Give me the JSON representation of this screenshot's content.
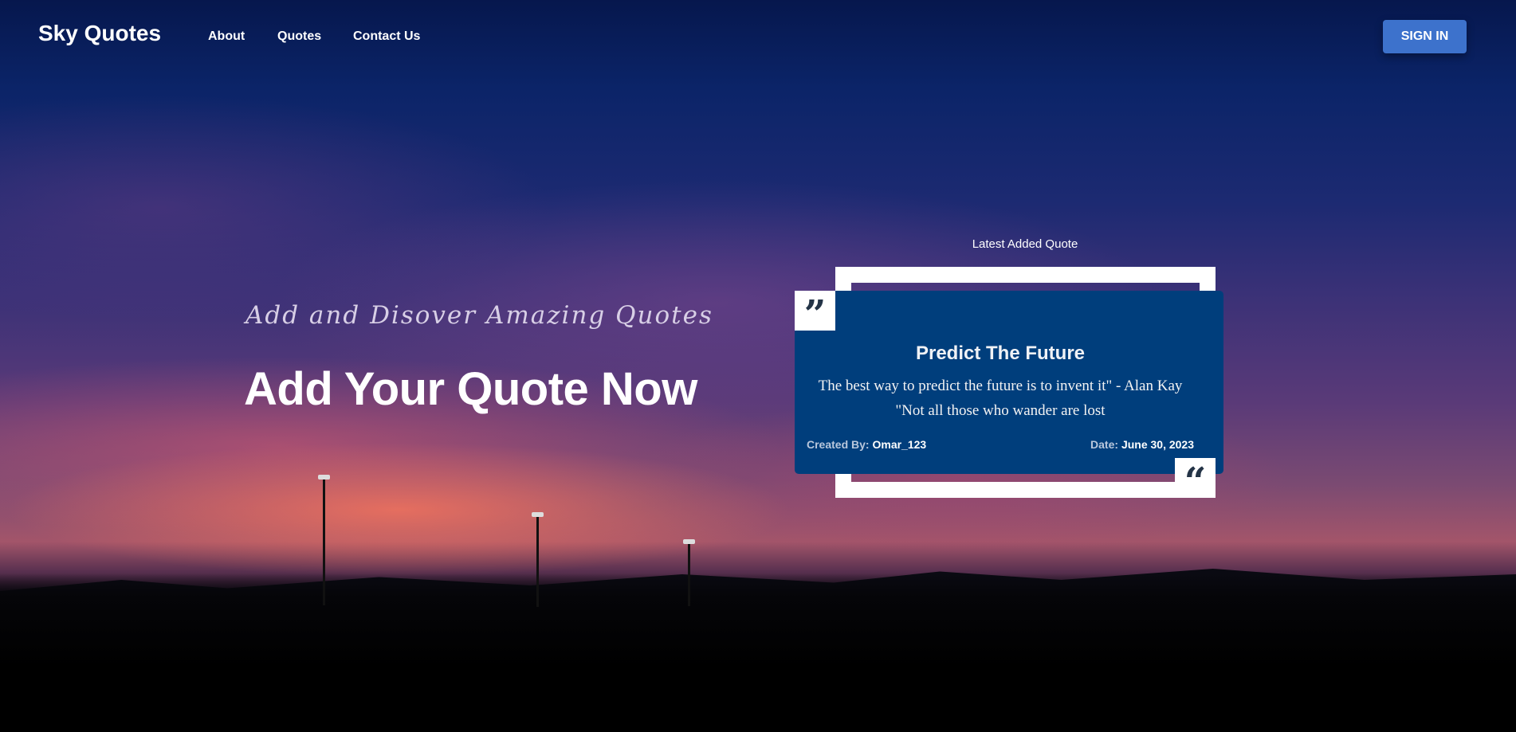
{
  "nav": {
    "logo": "Sky Quotes",
    "links": [
      "About",
      "Quotes",
      "Contact Us"
    ],
    "sign_in": "SIGN IN"
  },
  "hero": {
    "subtitle": "Add and Disover Amazing Quotes",
    "title": "Add Your Quote Now"
  },
  "latest": {
    "heading": "Latest Added Quote",
    "card": {
      "title": "Predict The Future",
      "line1": "The best way to predict the future is to invent it\" - Alan Kay",
      "line2": "\"Not all those who wander are lost",
      "created_label": "Created By:",
      "created_by": "Omar_123",
      "date_label": "Date:",
      "date": "June 30, 2023"
    },
    "icons": [
      "quote-right-icon",
      "quote-left-icon"
    ]
  },
  "colors": {
    "card": "#003e7c",
    "button": "#3d72cc"
  }
}
